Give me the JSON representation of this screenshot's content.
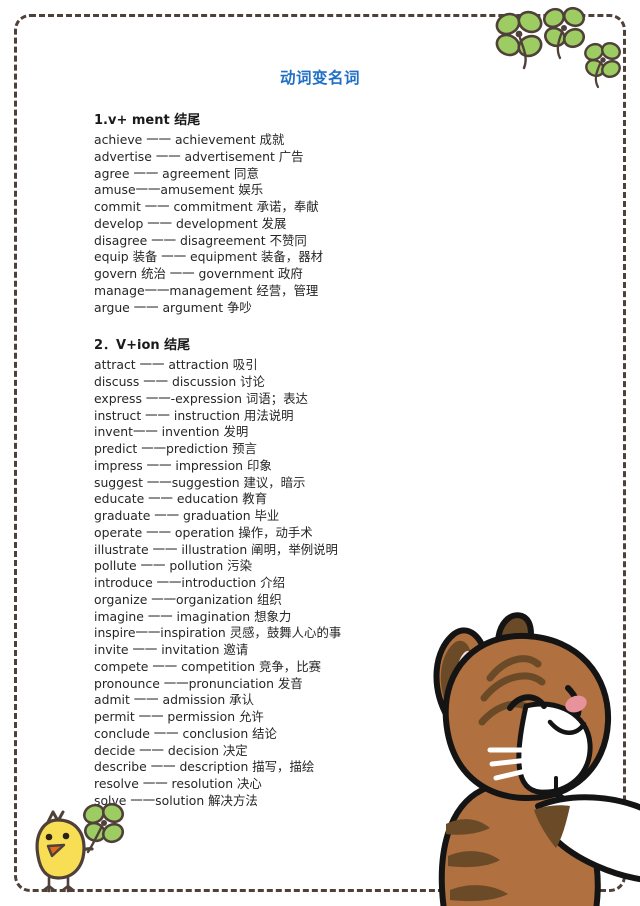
{
  "document": {
    "title": "动词变名词",
    "title_color": "#1f6fc4",
    "background_color": "#ffffff",
    "border_color": "#4f4039"
  },
  "sections": [
    {
      "heading": "1.v+ ment 结尾",
      "entries": [
        "achieve 一一 achievement 成就",
        "advertise 一一 advertisement 广告",
        "agree 一一 agreement 同意",
        "amuse一一amusement 娱乐",
        "commit 一一 commitment 承诺，奉献",
        "develop 一一 development 发展",
        "disagree 一一 disagreement 不赞同",
        "equip 装备 一一 equipment 装备，器材",
        "govern 统治 一一 government 政府",
        "manage一一management 经营，管理",
        "argue 一一 argument 争吵"
      ]
    },
    {
      "heading": "2．V+ion 结尾",
      "entries": [
        "attract 一一 attraction 吸引",
        "discuss 一一 discussion 讨论",
        "express 一一-expression 词语；表达",
        "instruct 一一 instruction 用法说明",
        "invent一一 invention 发明",
        "predict 一一prediction 预言",
        "impress 一一 impression 印象",
        "suggest 一一suggestion 建议，暗示",
        "educate 一一 education 教育",
        "graduate 一一 graduation 毕业",
        "operate 一一 operation 操作，动手术",
        "illustrate 一一 illustration 阐明，举例说明",
        "pollute 一一 pollution 污染",
        "introduce 一一introduction 介绍",
        "organize 一一organization 组织",
        "imagine 一一 imagination 想象力",
        "inspire一一inspiration 灵感，鼓舞人心的事",
        "invite 一一 invitation 邀请",
        "compete 一一 competition 竞争，比赛",
        "pronounce 一一pronunciation 发音",
        "admit 一一 admission 承认",
        "permit 一一 permission 允许",
        "conclude 一一 conclusion 结论",
        "decide 一一 decision 决定",
        "describe 一一 description 描写，描绘",
        "resolve 一一 resolution 决心",
        "solve 一一solution 解决方法"
      ]
    }
  ],
  "decorations": {
    "clover_leaf_color": "#9ccc62",
    "clover_outline_color": "#4f4039",
    "chick_body_color": "#f7de55",
    "chick_beak_color": "#e06a1c",
    "cat_fur_color": "#b0703f",
    "cat_stripe_color": "#6b4a28",
    "cat_muzzle_color": "#ffffff",
    "cat_cheek_color": "#e8939b",
    "cat_inner_ear_color": "#f9ded9",
    "cat_outline_color": "#141414"
  }
}
